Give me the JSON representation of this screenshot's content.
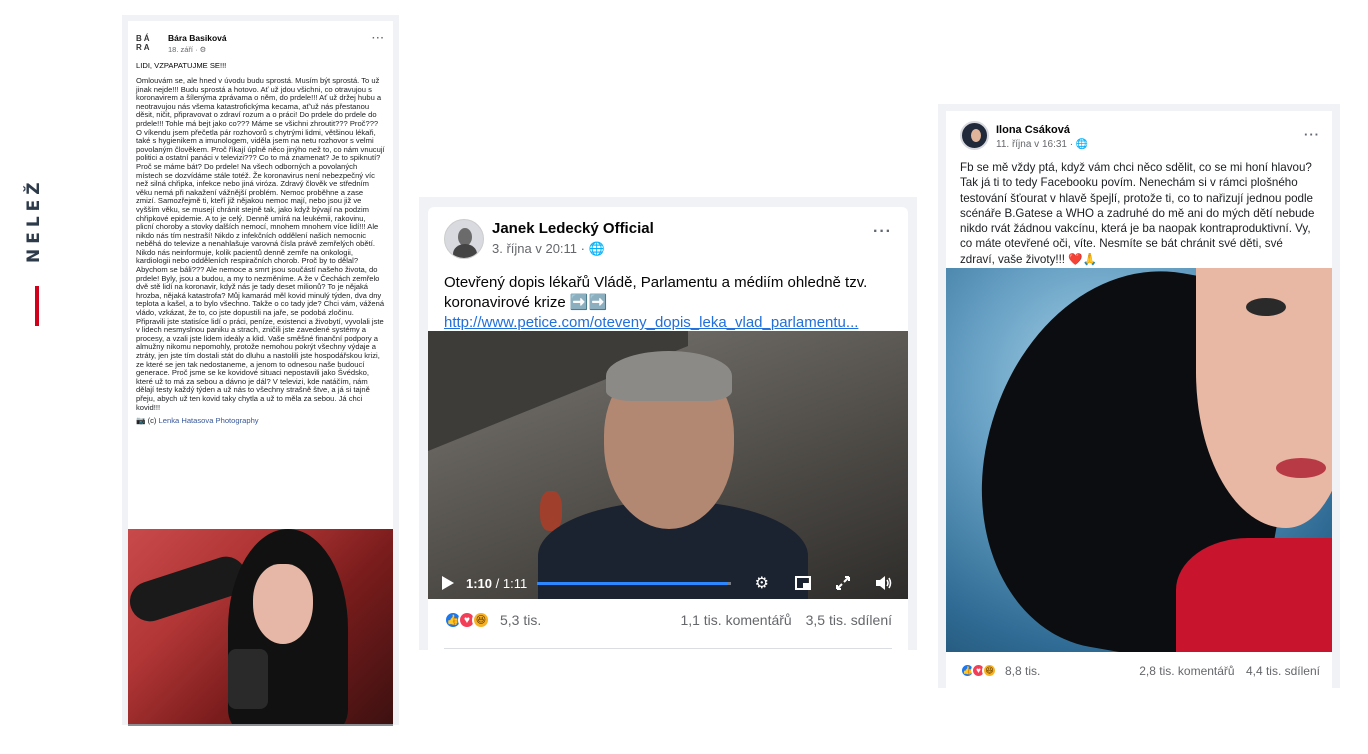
{
  "side": {
    "label": "NELEŽ"
  },
  "post1": {
    "avatar_text": "BÁ RA",
    "author": "Bára Basiková",
    "date": "18. září · ⚙",
    "more": "···",
    "title": "LIDI, VZPAPATUJME SE!!!",
    "body": "Omlouvám se, ale hned v úvodu budu sprostá. Musím být sprostá. To už jinak nejde!!! Budu sprostá a hotovo. Ať už jdou všichni, co otravujou s koronavirem a šílenýma zprávama o něm, do prdele!!! Ať už držej hubu a neotravujou nás všema katastrofickýma kecama, ať'už nás přestanou děsit, ničit, připravovat o zdraví rozum a o práci! Do prdele do prdele do prdele!!! Tohle má bejt jako co??? Máme se všichni zhroutit??? Proč??? O víkendu jsem přečetla pár rozhovorů s chytrými lidmi, většinou lékaři, také s hygienikem a imunologem, viděla jsem na netu rozhovor s velmi povolaným člověkem. Proč říkají úplně něco jinýho než to, co nám vnucují politici a ostatní panáci v televizi??? Co to má znamenat? Je to spiknutí? Proč se máme bát? Do prdele! Na všech odborných a povolaných místech se dozvídáme stále totéž. Že koronavirus není nebezpečný víc než silná chřipka, infekce nebo jiná viróza. Zdravý člověk ve středním věku nemá při nakažení vážnější problém. Nemoc proběhne a zase zmizí. Samozřejmě ti, kteří již nějakou nemoc mají, nebo jsou již ve vyšším věku, se musejí chránit stejně tak, jako když bývají na podzim chřipkové epidemie. A to je celý. Denně umírá na leukémii, rakovinu, plicní choroby a stovky dalších nemocí, mnohem mnohem více lidí!!! Ale nikdo nás tím nestraší! Nikdo z infekčních oddělení našich nemocnic neběhá do televize a nenahlašuje varovná čísla právě zemřelých obětí. Nikdo nás neinformuje, kolik pacientů denně zemře na onkologii, kardiologii nebo odděleních respiračních chorob. Proč by to dělal? Abychom se báli??? Ale nemoce a smrt jsou součástí našeho života, do prdele! Byly, jsou a budou, a my to nezměníme. A že v Čechách zemřelo dvě stě lidí na koronavir, když nás je tady deset milionů? To je nějaká hrozba, nějaká katastrofa? Můj kamarád měl kovid minulý týden, dva dny teplota a kašel, a to bylo všechno. Takže o co tady jde? Chci vám, vážená vládo, vzkázat, že to, co jste dopustili na jaře, se podobá zločinu. Připravili jste statisíce lidí o práci, peníze, existenci a živobytí, vyvolali jste v lidech nesmyslnou paniku a strach, zničili jste zavedené systémy a procesy, a vzali jste lidem ideály a klid. Vaše směšné finanční podpory a almužny nikomu nepomohly, protože nemohou pokrýt všechny výdaje a ztráty, jen jste tím dostali stát do dluhu a nastolili jste hospodářskou krizi, ze které se jen tak nedostaneme, a jenom to odnesou naše budoucí generace. Proč jsme se ke kovidové situaci nepostavili jako Švédsko, které už to má za sebou a dávno je dál? V televizi, kde natáčím, nám dělají testy každý týden a už nás to všechny strašně štve, a já si tajně přeju, abych už ten kovid taky chytla a už to měla za sebou. Já chci kovid!!!",
    "credit_prefix": "📷 (c)",
    "credit_link": "Lenka Hatasova Photography"
  },
  "post2": {
    "author": "Janek Ledecký Official",
    "date": "3. října v 20:11 · 🌐",
    "more": "···",
    "text": "Otevřený dopis lékařů Vládě, Parlamentu a médiím ohledně tzv. koronavirové krize ➡️➡️",
    "link": "http://www.petice.com/oteveny_dopis_leka_vlad_parlamentu...",
    "video": {
      "current": "1:10",
      "duration": "/ 1:11",
      "progress_fraction": 0.985
    },
    "reactions": "5,3 tis.",
    "comments": "1,1 tis. komentářů",
    "shares": "3,5 tis. sdílení"
  },
  "post3": {
    "author": "Ilona Csáková",
    "date": "11. října v 16:31 · 🌐",
    "more": "···",
    "text": "Fb se mě vždy ptá, když vám chci něco sdělit, co se mi honí hlavou? Tak já ti to tedy Facebooku povím. Nenechám si v rámci plošného testování šťourat v hlavě špejlí, protože ti, co to nařizují jednou podle scénáře B.Gatese a WHO a zadruhé do mě ani do mých dětí nebude nikdo rvát žádnou vakcínu, která je ba naopak kontraproduktivní. Vy, co máte otevřené oči, víte. Nesmíte se bát chránit své děti, své zdraví, vaše životy!!! ❤️🙏",
    "reactions": "8,8 tis.",
    "comments": "2,8 tis. komentářů",
    "shares": "4,4 tis. sdílení"
  },
  "colors": {
    "accent_red": "#d0021b",
    "fb_blue": "#1877f2",
    "link_blue": "#216fdb",
    "muted": "#65676b"
  }
}
